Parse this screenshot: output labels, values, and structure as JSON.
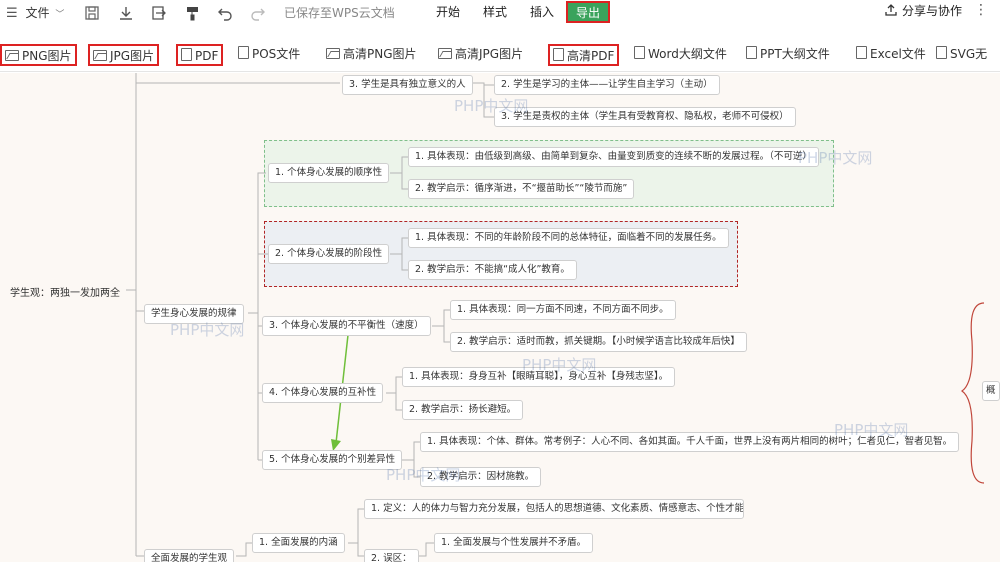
{
  "toolbar": {
    "file_label": "文件",
    "saved_status": "已保存至WPS云文档",
    "tabs": [
      "开始",
      "样式",
      "插入"
    ],
    "export_tab": "导出",
    "share_label": "分享与协作"
  },
  "export_bar": {
    "items": [
      "PNG图片",
      "JPG图片",
      "PDF",
      "POS文件",
      "高清PNG图片",
      "高清JPG图片",
      "高清PDF",
      "Word大纲文件",
      "PPT大纲文件",
      "Excel文件",
      "SVG无"
    ]
  },
  "mindmap": {
    "root": "学生观：两独一发加两全",
    "top_partial": {
      "node": "3. 学生是具有独立意义的人",
      "child1": "2. 学生是学习的主体——让学生自主学习（主动）",
      "child2": "3. 学生是责权的主体（学生具有受教育权、隐私权，老师不可侵权）"
    },
    "branch": "学生身心发展的规律",
    "laws": [
      {
        "title": "1. 个体身心发展的顺序性",
        "c1": "1. 具体表现：由低级到高级、由简单到复杂、由量变到质变的连续不断的发展过程。（不可逆）",
        "c2": "2. 教学启示：循序渐进，不“揠苗助长”“陵节而施”"
      },
      {
        "title": "2. 个体身心发展的阶段性",
        "c1": "1. 具体表现：不同的年龄阶段不同的总体特征，面临着不同的发展任务。",
        "c2": "2. 教学启示：不能搞“成人化”教育。"
      },
      {
        "title": "3. 个体身心发展的不平衡性（速度）",
        "c1": "1. 具体表现：同一方面不同速，不同方面不同步。",
        "c2": "2. 教学启示：适时而教，抓关键期。【小时候学语言比较成年后快】"
      },
      {
        "title": "4. 个体身心发展的互补性",
        "c1": "1. 具体表现：身身互补【眼睛耳聪】，身心互补【身残志坚】。",
        "c2": "2. 教学启示：扬长避短。"
      },
      {
        "title": "5. 个体身心发展的个别差异性",
        "c1": "1. 具体表现：个体、群体。常考例子：人心不同、各如其面。千人千面，世界上没有两片相同的树叶；仁者见仁，智者见智。",
        "c2": "2. 教学启示：因材施教。"
      }
    ],
    "bottom": {
      "branch": "全面发展的学生观",
      "node": "1. 全面发展的内涵",
      "def": "1. 定义：人的体力与智力充分发展，包括人的思想道德、文化素质、情感意志、个性才能",
      "wuqu": "2. 误区：",
      "wuqu_c1": "1. 全面发展与个性发展并不矛盾。"
    },
    "right_partial": "概",
    "watermark": "PHP中文网"
  }
}
